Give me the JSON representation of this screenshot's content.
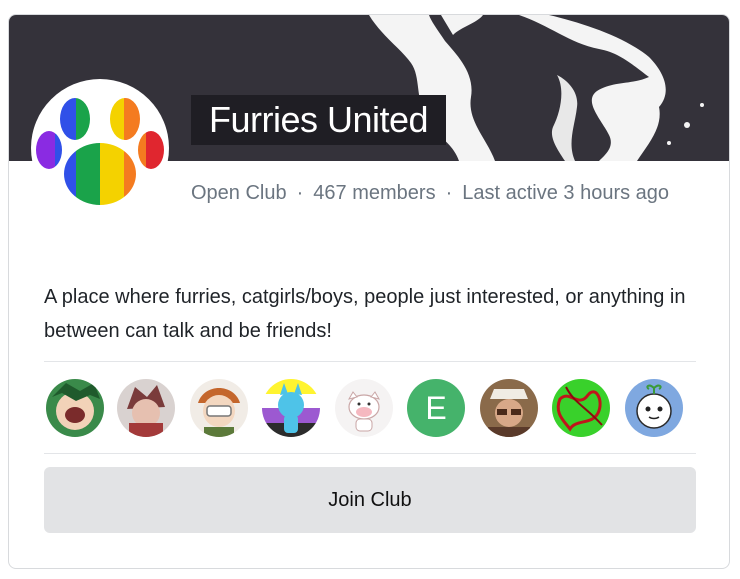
{
  "club": {
    "name": "Furries United",
    "type": "Open Club",
    "members": "467 members",
    "last_active": "Last active 3 hours ago",
    "separator": "·",
    "description": "A place where furries, catgirls/boys, people just interested, or anything in between can talk and be friends!"
  },
  "avatars": [
    {
      "name": "member-avatar-1"
    },
    {
      "name": "member-avatar-2"
    },
    {
      "name": "member-avatar-3"
    },
    {
      "name": "member-avatar-4"
    },
    {
      "name": "member-avatar-5"
    },
    {
      "name": "member-avatar-6",
      "letter": "E",
      "color": "#45b36b"
    },
    {
      "name": "member-avatar-7"
    },
    {
      "name": "member-avatar-8"
    },
    {
      "name": "member-avatar-9"
    }
  ],
  "actions": {
    "join_label": "Join Club"
  },
  "colors": {
    "banner": "#34323a",
    "button": "#e2e3e5",
    "meta_text": "#6b7580"
  }
}
